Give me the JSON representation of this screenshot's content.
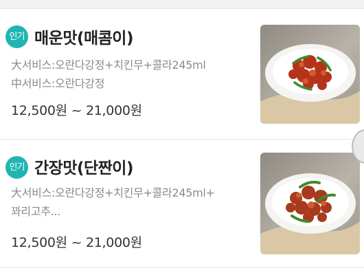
{
  "menu_items": [
    {
      "badge": "인기",
      "title": "매운맛(매콤이)",
      "desc_lines": [
        "大서비스:오란다강정+치킨무+콜라245ml",
        "中서비스:오란다강정"
      ],
      "price": "12,500원 ~ 21,000원",
      "image_icon": "spicy-chicken-photo"
    },
    {
      "badge": "인기",
      "title": "간장맛(단짠이)",
      "desc_lines": [
        "大서비스:오란다강정+치킨무+콜라245ml+",
        "꽈리고추..."
      ],
      "price": "12,500원 ~ 21,000원",
      "image_icon": "soy-chicken-photo"
    }
  ]
}
